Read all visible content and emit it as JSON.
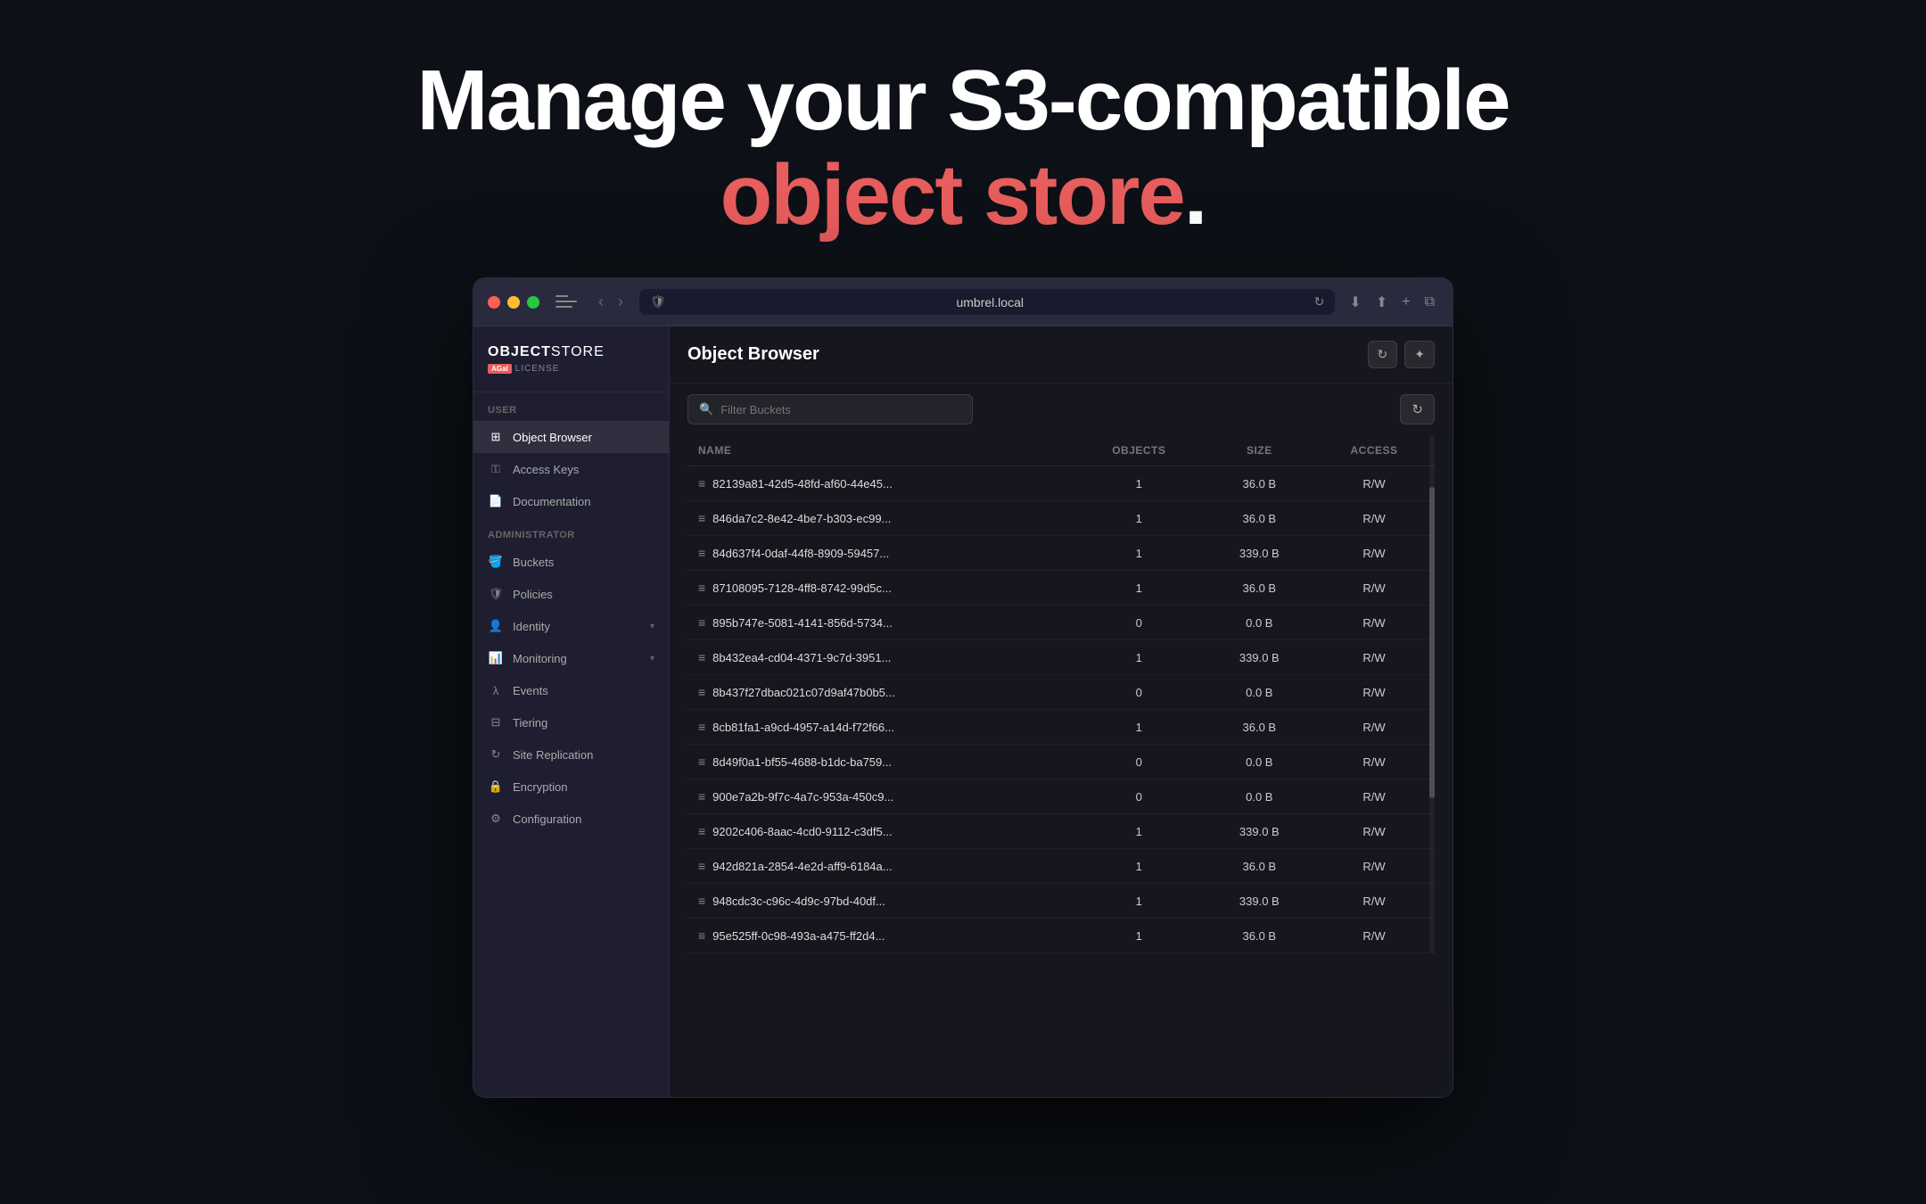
{
  "hero": {
    "line1": "Manage your S3-compatible",
    "line2_prefix": "object store",
    "line2_suffix": "."
  },
  "browser": {
    "url": "umbrel.local",
    "logo": {
      "object": "OBJECT",
      "store": "STORE",
      "badge": "AGaI",
      "license": "LICENSE"
    },
    "sidebar": {
      "user_label": "User",
      "admin_label": "Administrator",
      "user_items": [
        {
          "label": "Object Browser",
          "icon": "grid"
        },
        {
          "label": "Access Keys",
          "icon": "key"
        },
        {
          "label": "Documentation",
          "icon": "doc"
        }
      ],
      "admin_items": [
        {
          "label": "Buckets",
          "icon": "bucket"
        },
        {
          "label": "Policies",
          "icon": "shield"
        },
        {
          "label": "Identity",
          "icon": "person",
          "has_chevron": true
        },
        {
          "label": "Monitoring",
          "icon": "chart",
          "has_chevron": true
        },
        {
          "label": "Events",
          "icon": "lambda"
        },
        {
          "label": "Tiering",
          "icon": "layers"
        },
        {
          "label": "Site Replication",
          "icon": "sync"
        },
        {
          "label": "Encryption",
          "icon": "lock"
        },
        {
          "label": "Configuration",
          "icon": "gear"
        }
      ]
    },
    "main": {
      "title": "Object Browser",
      "search_placeholder": "Filter Buckets",
      "table": {
        "columns": [
          "Name",
          "Objects",
          "Size",
          "Access"
        ],
        "rows": [
          {
            "name": "82139a81-42d5-48fd-af60-44e45...",
            "objects": "1",
            "size": "36.0 B",
            "access": "R/W"
          },
          {
            "name": "846da7c2-8e42-4be7-b303-ec99...",
            "objects": "1",
            "size": "36.0 B",
            "access": "R/W"
          },
          {
            "name": "84d637f4-0daf-44f8-8909-59457...",
            "objects": "1",
            "size": "339.0 B",
            "access": "R/W"
          },
          {
            "name": "87108095-7128-4ff8-8742-99d5c...",
            "objects": "1",
            "size": "36.0 B",
            "access": "R/W"
          },
          {
            "name": "895b747e-5081-4141-856d-5734...",
            "objects": "0",
            "size": "0.0 B",
            "access": "R/W"
          },
          {
            "name": "8b432ea4-cd04-4371-9c7d-3951...",
            "objects": "1",
            "size": "339.0 B",
            "access": "R/W"
          },
          {
            "name": "8b437f27dbac021c07d9af47b0b5...",
            "objects": "0",
            "size": "0.0 B",
            "access": "R/W"
          },
          {
            "name": "8cb81fa1-a9cd-4957-a14d-f72f66...",
            "objects": "1",
            "size": "36.0 B",
            "access": "R/W"
          },
          {
            "name": "8d49f0a1-bf55-4688-b1dc-ba759...",
            "objects": "0",
            "size": "0.0 B",
            "access": "R/W"
          },
          {
            "name": "900e7a2b-9f7c-4a7c-953a-450c9...",
            "objects": "0",
            "size": "0.0 B",
            "access": "R/W"
          },
          {
            "name": "9202c406-8aac-4cd0-9112-c3df5...",
            "objects": "1",
            "size": "339.0 B",
            "access": "R/W"
          },
          {
            "name": "942d821a-2854-4e2d-aff9-6184a...",
            "objects": "1",
            "size": "36.0 B",
            "access": "R/W"
          },
          {
            "name": "948cdc3c-c96c-4d9c-97bd-40df...",
            "objects": "1",
            "size": "339.0 B",
            "access": "R/W"
          },
          {
            "name": "95e525ff-0c98-493a-a475-ff2d4...",
            "objects": "1",
            "size": "36.0 B",
            "access": "R/W"
          }
        ]
      }
    }
  }
}
